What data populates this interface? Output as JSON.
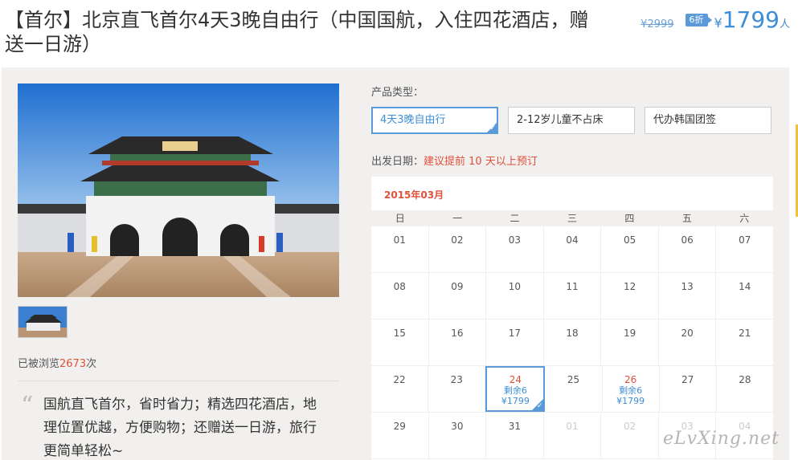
{
  "header": {
    "title": "【首尔】北京直飞首尔4天3晚自由行（中国国航，入住四花酒店，赠送一日游）",
    "old_price": "¥2999",
    "discount": "6折",
    "currency": "¥",
    "price": "1799",
    "unit": "人"
  },
  "gallery": {
    "views_prefix": "已被浏览",
    "views_count": "2673",
    "views_suffix": "次"
  },
  "description": {
    "quote": "“",
    "text": "国航直飞首尔，省时省力；精选四花酒店，地理位置优越，方便购物；还赠送一日游，旅行更简单轻松~"
  },
  "product": {
    "type_label": "产品类型：",
    "types": [
      "4天3晚自由行",
      "2-12岁儿童不占床",
      "代办韩国团签"
    ],
    "date_label": "出发日期：",
    "date_notice": "建议提前 10 天以上预订"
  },
  "calendar": {
    "month": "2015年03月",
    "weekdays": [
      "日",
      "一",
      "二",
      "三",
      "四",
      "五",
      "六"
    ],
    "rows": [
      [
        {
          "d": "01"
        },
        {
          "d": "02"
        },
        {
          "d": "03"
        },
        {
          "d": "04"
        },
        {
          "d": "05"
        },
        {
          "d": "06"
        },
        {
          "d": "07"
        }
      ],
      [
        {
          "d": "08"
        },
        {
          "d": "09"
        },
        {
          "d": "10"
        },
        {
          "d": "11"
        },
        {
          "d": "12"
        },
        {
          "d": "13"
        },
        {
          "d": "14"
        }
      ],
      [
        {
          "d": "15"
        },
        {
          "d": "16"
        },
        {
          "d": "17"
        },
        {
          "d": "18"
        },
        {
          "d": "19"
        },
        {
          "d": "20"
        },
        {
          "d": "21"
        }
      ],
      [
        {
          "d": "22"
        },
        {
          "d": "23"
        },
        {
          "d": "24",
          "rem": "剩余6",
          "price": "¥1799",
          "selected": true
        },
        {
          "d": "25"
        },
        {
          "d": "26",
          "rem": "剩余6",
          "price": "¥1799"
        },
        {
          "d": "27"
        },
        {
          "d": "28"
        }
      ],
      [
        {
          "d": "29"
        },
        {
          "d": "30"
        },
        {
          "d": "31"
        },
        {
          "d": "01",
          "dim": true
        },
        {
          "d": "02",
          "dim": true
        },
        {
          "d": "03",
          "dim": true
        },
        {
          "d": "04",
          "dim": true
        }
      ]
    ]
  },
  "watermark": "eLvXing.net",
  "colors": {
    "accent": "#3d8ed6",
    "warning": "#e0503a",
    "panel_bg": "#f2f0ee"
  }
}
